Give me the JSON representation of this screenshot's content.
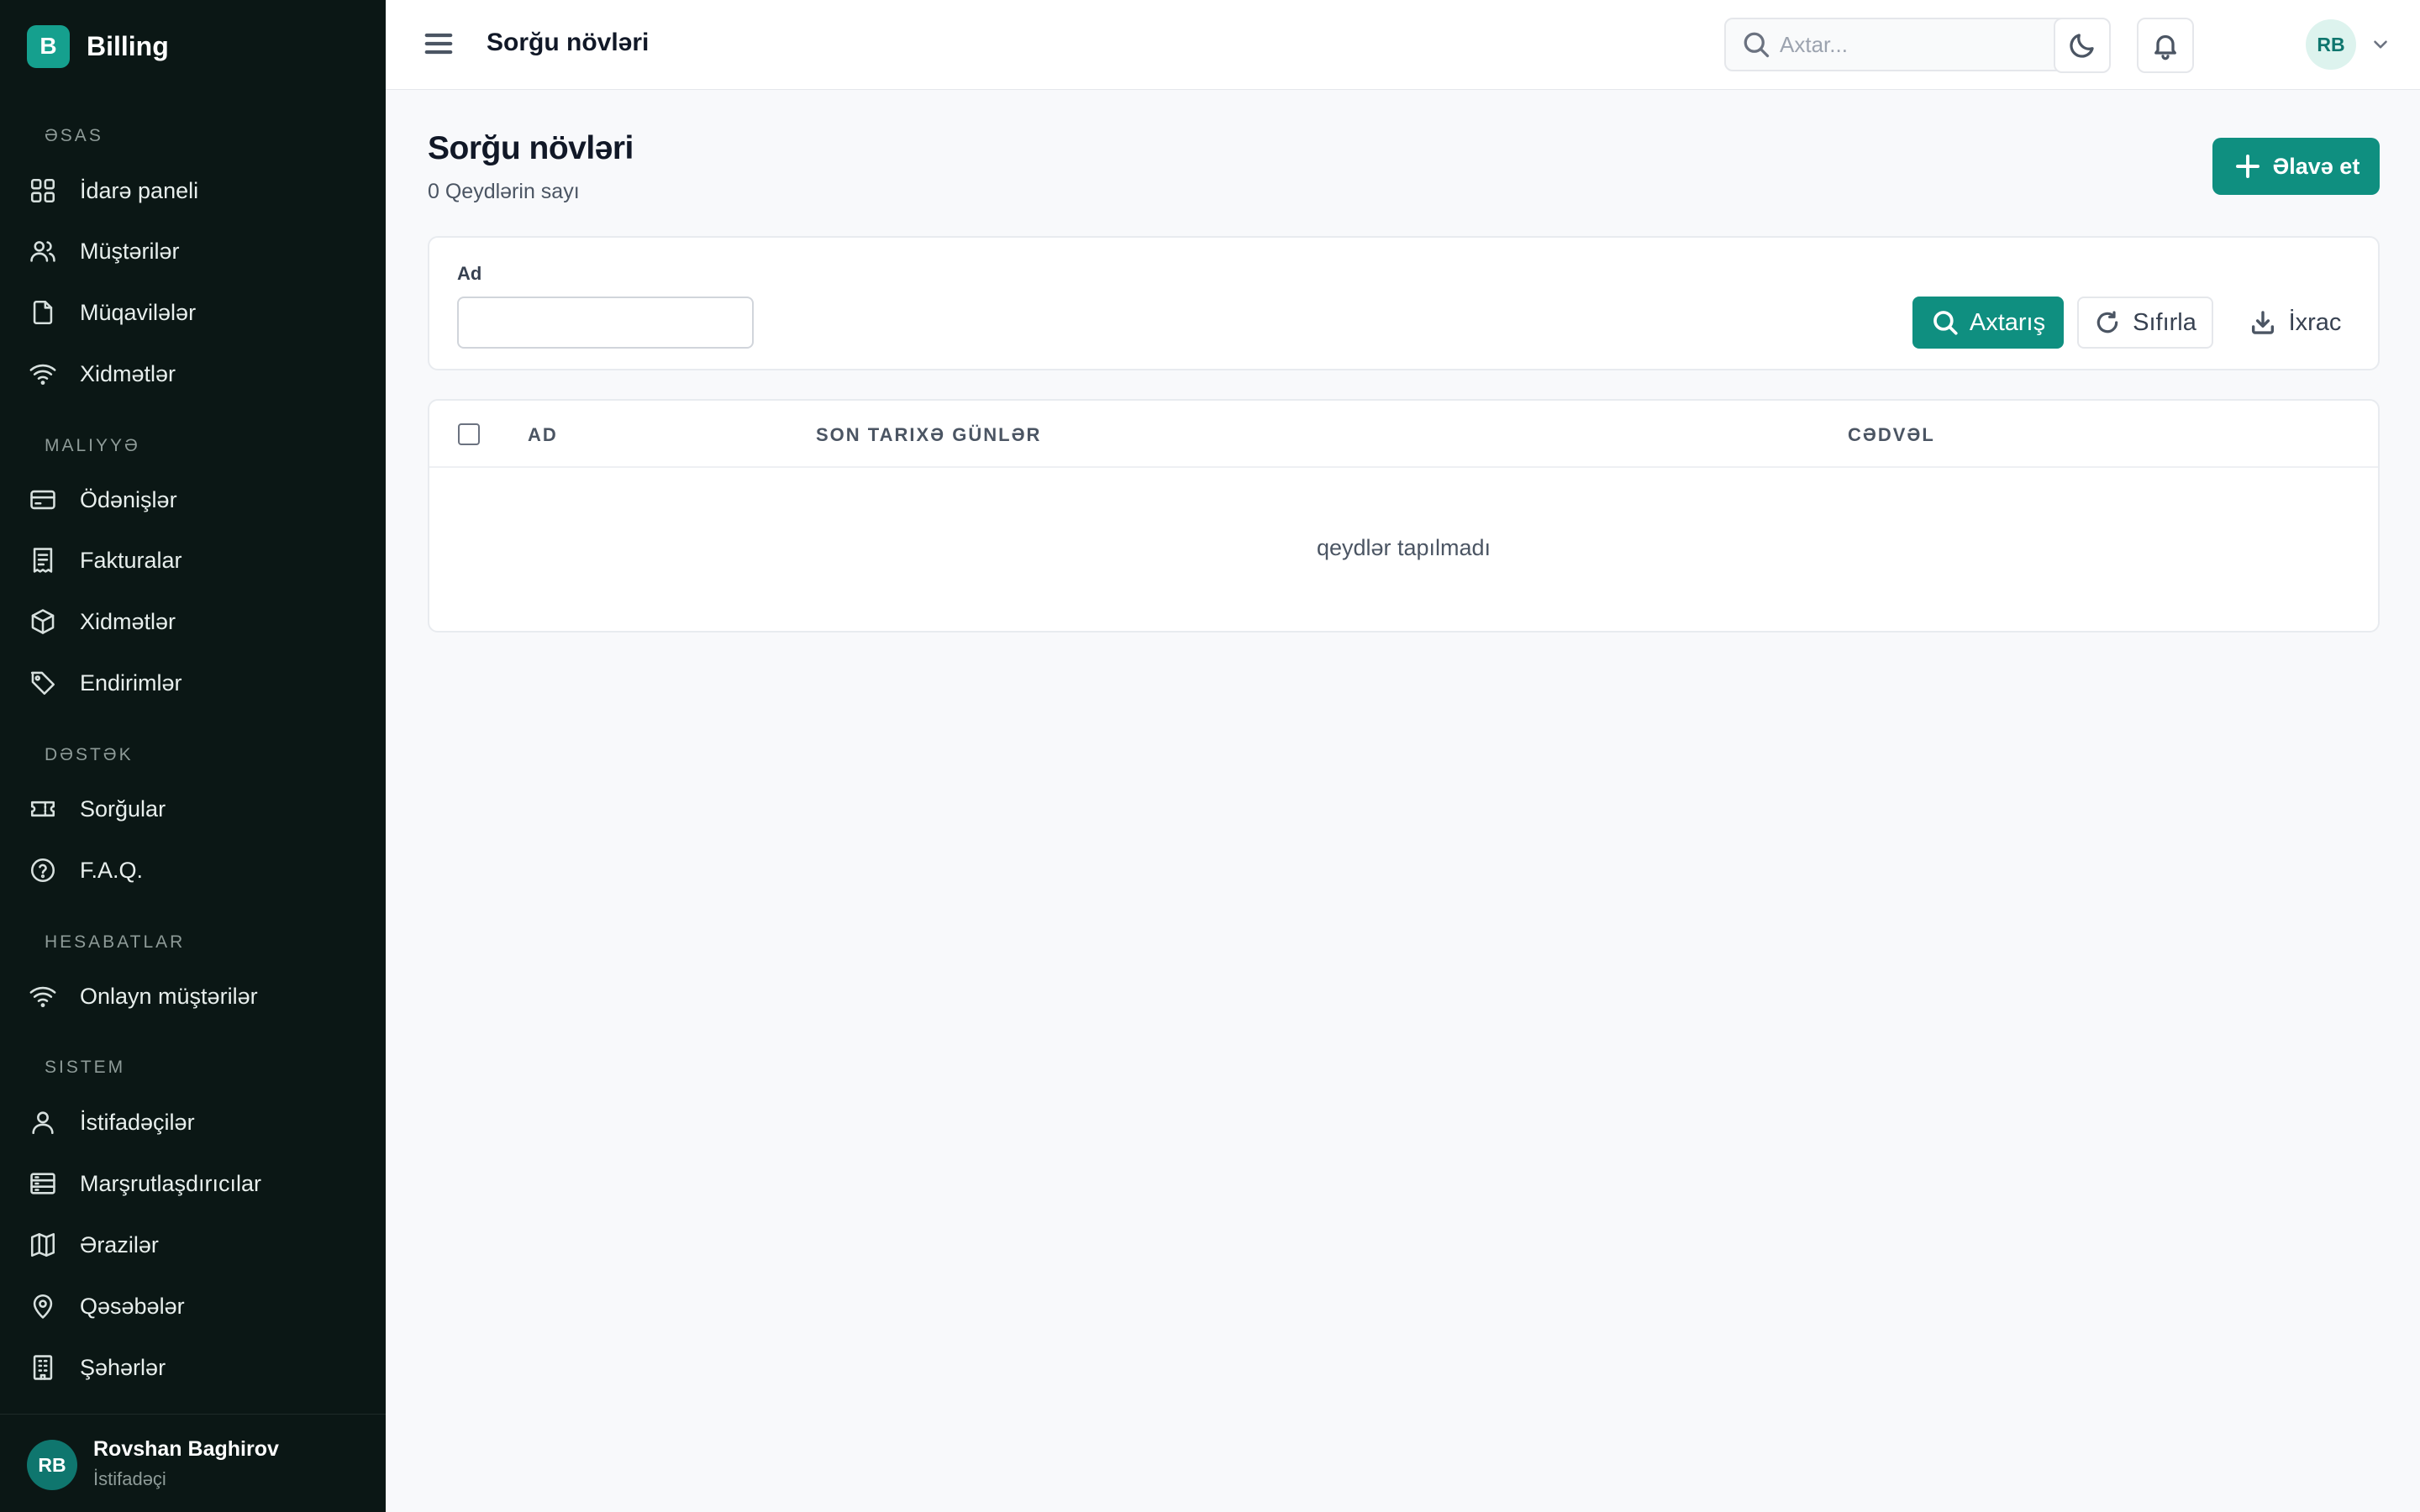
{
  "brand": {
    "logo_letter": "B",
    "name": "Billing"
  },
  "sidebar": {
    "sections": [
      {
        "label": "ƏSAS",
        "items": [
          "İdarə paneli",
          "Müştərilər",
          "Müqavilələr",
          "Xidmətlər"
        ]
      },
      {
        "label": "MALIYYƏ",
        "items": [
          "Ödənişlər",
          "Fakturalar",
          "Xidmətlər",
          "Endirimlər"
        ]
      },
      {
        "label": "DƏSTƏK",
        "items": [
          "Sorğular",
          "F.A.Q."
        ]
      },
      {
        "label": "HESABATLAR",
        "items": [
          "Onlayn müştərilər"
        ]
      },
      {
        "label": "SISTEM",
        "items": [
          "İstifadəçilər",
          "Marşrutlaşdırıcılar",
          "Ərazilər",
          "Qəsəbələr",
          "Şəhərlər"
        ]
      }
    ],
    "footer": {
      "initials": "RB",
      "name": "Rovshan Baghirov",
      "role": "İstifadəçi"
    }
  },
  "topbar": {
    "title": "Sorğu növləri",
    "search_placeholder": "Axtar...",
    "avatar_initials": "RB"
  },
  "page": {
    "title": "Sorğu növləri",
    "record_count": "0 Qeydlərin sayı",
    "add_label": "Əlavə et"
  },
  "filter": {
    "name_label": "Ad",
    "name_value": "",
    "search_label": "Axtarış",
    "reset_label": "Sıfırla",
    "export_label": "İxrac"
  },
  "table": {
    "columns": [
      "AD",
      "SON TARIXƏ GÜNLƏR",
      "CƏDVƏL"
    ],
    "rows": [],
    "empty_message": "qeydlər tapılmadı"
  },
  "colors": {
    "accent": "#0f8f80",
    "sidebar_bg": "#0b1715",
    "page_bg": "#f8f9fb"
  }
}
